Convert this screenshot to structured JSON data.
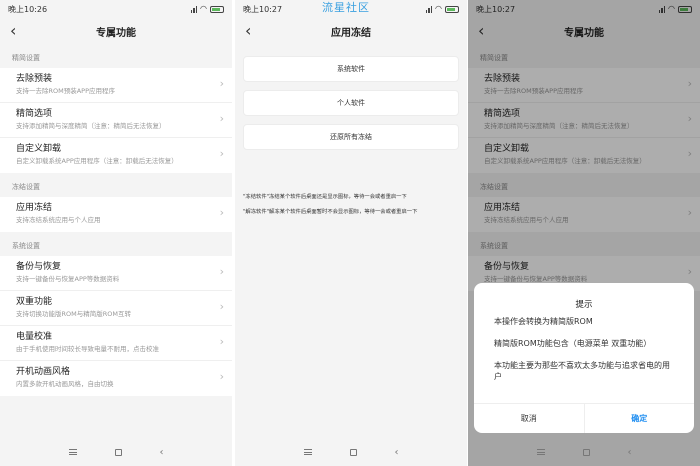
{
  "watermark": "流星社区",
  "screen1": {
    "time": "晚上10:26",
    "title": "专属功能",
    "sections": [
      {
        "header": "精简设置",
        "items": [
          {
            "title": "去除预装",
            "subtitle": "支持一去除ROM预装APP应用程序"
          },
          {
            "title": "精简选项",
            "subtitle": "支持添加精简与深度精简（注意：精简后无法恢复）"
          },
          {
            "title": "自定义卸载",
            "subtitle": "自定义卸载系统APP应用程序（注意：卸载后无法恢复）"
          }
        ]
      },
      {
        "header": "冻结设置",
        "items": [
          {
            "title": "应用冻结",
            "subtitle": "支持冻结系统应用与个人应用"
          }
        ]
      },
      {
        "header": "系统设置",
        "items": [
          {
            "title": "备份与恢复",
            "subtitle": "支持一键备份与恢复APP等数据资料"
          },
          {
            "title": "双重功能",
            "subtitle": "支持切换功能版ROM与精简版ROM互转"
          },
          {
            "title": "电量校准",
            "subtitle": "由于手机使用时间较长导致电量不耐用，点击校准"
          },
          {
            "title": "开机动画风格",
            "subtitle": "内置多款开机动画风格，自由切换"
          }
        ]
      }
    ]
  },
  "screen2": {
    "time": "晚上10:27",
    "title": "应用冻结",
    "buttons": [
      "系统软件",
      "个人软件",
      "还原所有冻结"
    ],
    "notes": [
      "\"冻结软件\"冻结某个软件后桌面还是显示图标，等待一会或者重启一下",
      "\"解冻软件\"解冻某个软件后桌面暂时不会显示图标，等待一会或者重启一下"
    ]
  },
  "screen3": {
    "time": "晚上10:27",
    "dialog": {
      "title": "提示",
      "line1": "本操作会转换为精简版ROM",
      "line2": "精简版ROM功能包含（电源菜单 双重功能）",
      "line3": "本功能主要为那些不喜欢太多功能与追求省电的用户",
      "cancel": "取消",
      "confirm": "确定"
    }
  },
  "colors": {
    "accent": "#1f8ef1",
    "watermark": "#3aa0e0",
    "battery": "#5cb85c"
  },
  "icons": [
    "back-icon",
    "chevron-right-icon",
    "signal-icon",
    "wifi-icon",
    "battery-icon",
    "nav-menu-icon",
    "nav-home-icon",
    "nav-back-icon"
  ]
}
